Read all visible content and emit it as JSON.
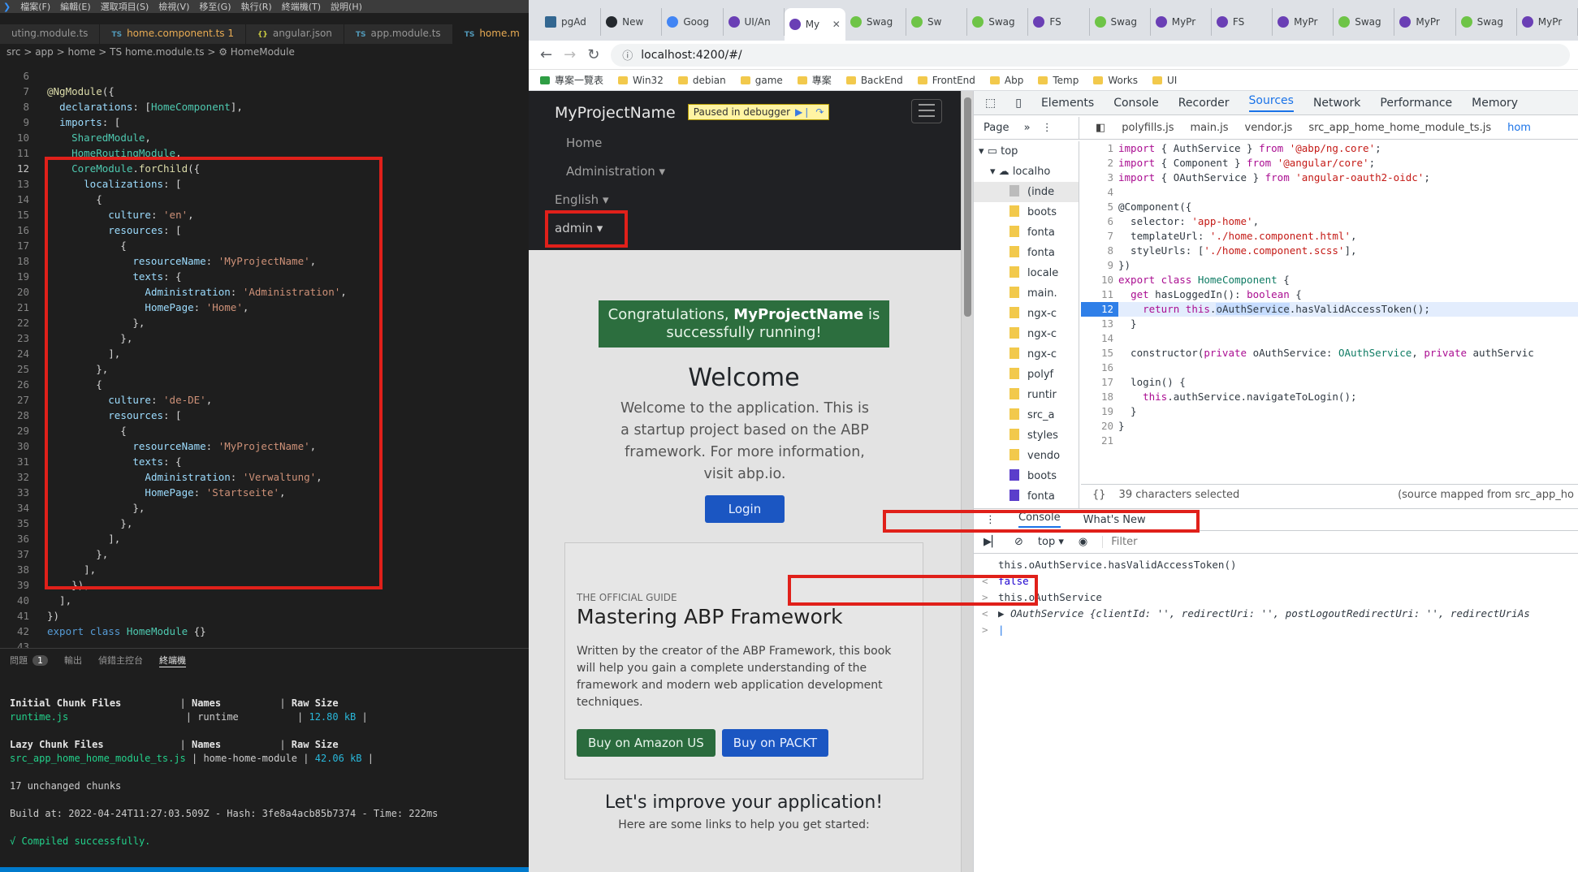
{
  "vscode": {
    "menu": [
      "檔案(F)",
      "編輯(E)",
      "選取項目(S)",
      "檢視(V)",
      "移至(G)",
      "執行(R)",
      "終端機(T)",
      "說明(H)"
    ],
    "tabs": [
      "uting.module.ts",
      "home.component.ts 1",
      "angular.json",
      "app.module.ts",
      "home.m"
    ],
    "breadcrumb": "src > app > home > TS home.module.ts > ⚙ HomeModule",
    "panel_tabs": [
      "問題",
      "輸出",
      "偵錯主控台",
      "終端機"
    ],
    "problems_count": "1",
    "terminal": {
      "h1": "Initial Chunk Files",
      "h1_names": "Names",
      "h1_size": "Raw Size",
      "r1_file": "runtime.js",
      "r1_name": "runtime",
      "r1_size": "12.80 kB",
      "h2": "Lazy Chunk Files",
      "r2_file": "src_app_home_home_module_ts.js",
      "r2_name": "home-home-module",
      "r2_size": "42.06 kB",
      "unchanged": "17 unchanged chunks",
      "build": "Build at: 2022-04-24T11:27:03.509Z - Hash: 3fe8a4acb85b7374 - Time: 222ms",
      "success": "√ Compiled successfully."
    }
  },
  "browser": {
    "tabs": [
      "pgAd",
      "New",
      "Goog",
      "UI/An",
      "My",
      "Swag",
      "Sw",
      "Swag",
      "FS",
      "Swag",
      "MyPr",
      "FS",
      "MyPr",
      "Swag",
      "MyPr",
      "Swag",
      "MyPr"
    ],
    "url": "localhost:4200/#/",
    "bookmarks": [
      "專案一覽表",
      "Win32",
      "debian",
      "game",
      "專案",
      "BackEnd",
      "FrontEnd",
      "Abp",
      "Temp",
      "Works",
      "UI"
    ]
  },
  "app": {
    "brand": "MyProjectName",
    "debug_label": "Paused in debugger",
    "nav_home": "Home",
    "nav_admin": "Administration",
    "nav_lang": "English",
    "nav_user": "admin",
    "congrats_a": "Congratulations,",
    "congrats_b": "MyProjectName",
    "congrats_c": "is successfully running!",
    "welcome_title": "Welcome",
    "welcome_text": "Welcome to the application. This is a startup project based on the ABP framework. For more information, visit abp.io.",
    "login": "Login",
    "guide_eyebrow": "THE OFFICIAL GUIDE",
    "guide_title": "Mastering ABP Framework",
    "guide_desc": "Written by the creator of the ABP Framework, this book will help you gain a complete understanding of the framework and modern web application development techniques.",
    "btn_amazon": "Buy on Amazon US",
    "btn_packt": "Buy on PACKT",
    "improve_title": "Let's improve your application!",
    "improve_text": "Here are some links to help you get started:"
  },
  "devtools": {
    "tabs": [
      "Elements",
      "Console",
      "Recorder",
      "Sources",
      "Network",
      "Performance",
      "Memory"
    ],
    "page_label": "Page",
    "file_tabs": [
      "polyfills.js",
      "main.js",
      "vendor.js",
      "src_app_home_home_module_ts.js",
      "hom"
    ],
    "tree": [
      "top",
      "localho",
      "(inde",
      "boots",
      "fonta",
      "fonta",
      "locale",
      "main.",
      "ngx-c",
      "ngx-c",
      "ngx-c",
      "polyf",
      "runtir",
      "src_a",
      "styles",
      "vendo",
      "boots",
      "fonta"
    ],
    "status_selected": "39 characters selected",
    "status_mapped": "(source mapped from src_app_ho",
    "drawer_tabs": [
      "Console",
      "What's New"
    ],
    "console_context": "top",
    "filter_placeholder": "Filter",
    "console": {
      "cmd1": "this.oAuthService.hasValidAccessToken()",
      "res1": "false",
      "cmd2": "this.oAuthService",
      "res2_class": "OAuthService",
      "res2_obj": "{clientId: '', redirectUri: '', postLogoutRedirectUri: '', redirectUriAs"
    }
  }
}
